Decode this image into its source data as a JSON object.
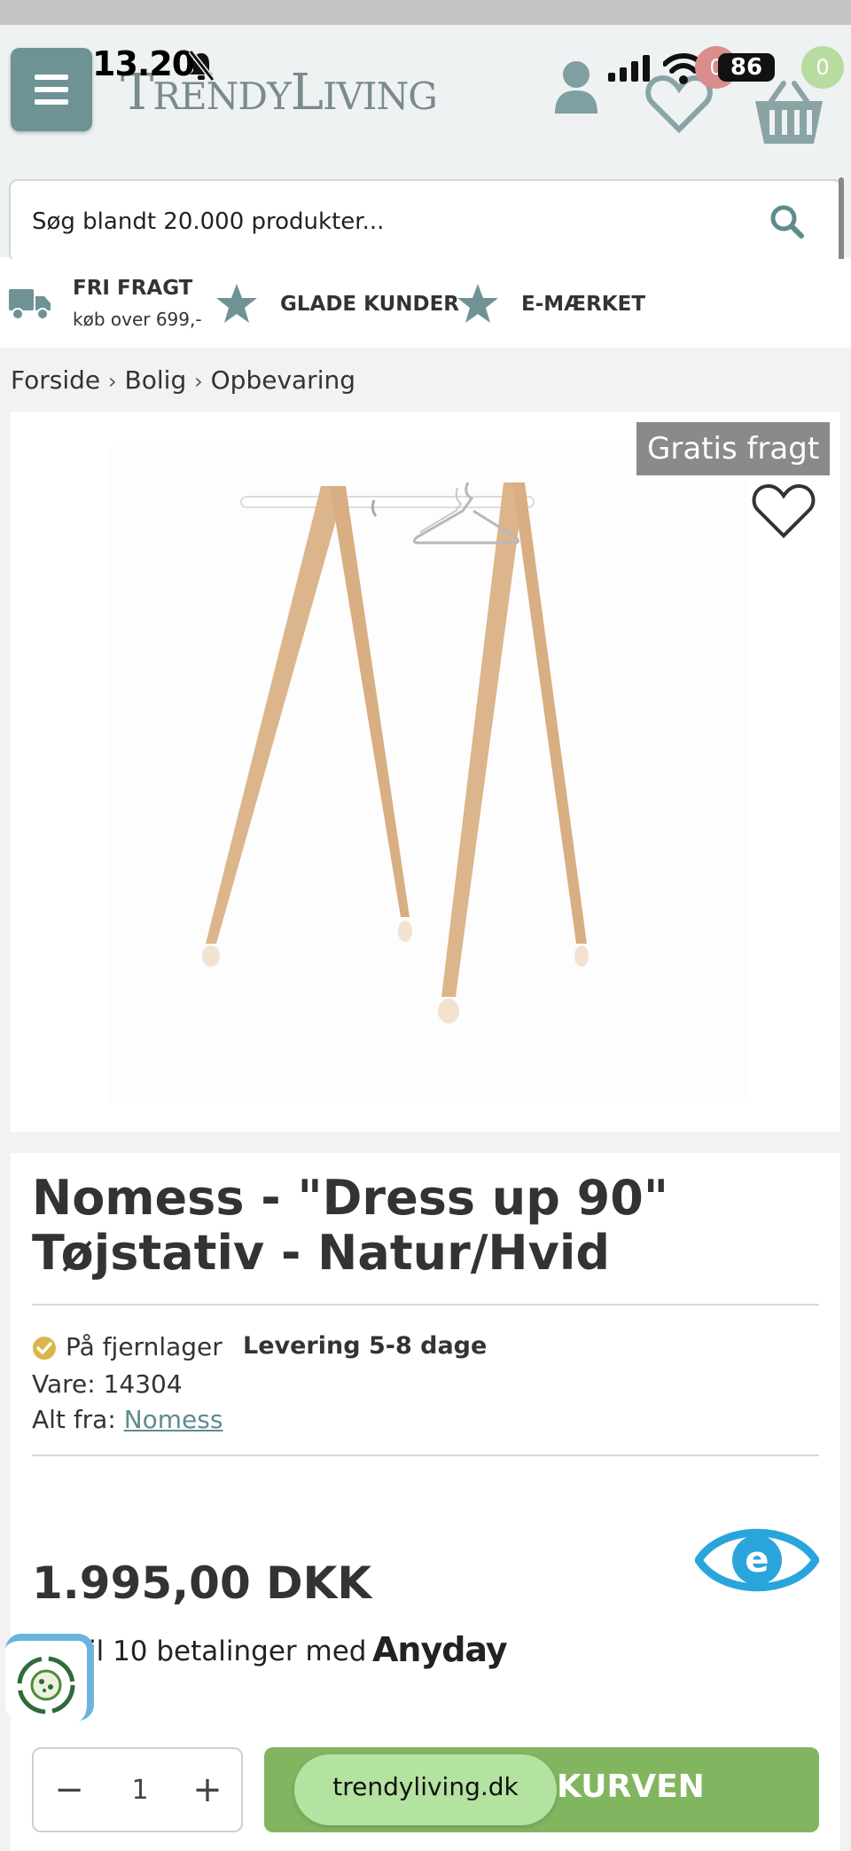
{
  "status": {
    "time": "13.20",
    "battery": "86"
  },
  "header": {
    "logo": {
      "first": "T",
      "rest1": "RENDY",
      "second": "L",
      "rest2": "IVING"
    },
    "wishlist_count": "0",
    "cart_count": "0"
  },
  "search": {
    "placeholder": "Søg blandt 20.000 produkter..."
  },
  "usp": {
    "free_shipping_title": "FRI FRAGT",
    "free_shipping_sub": "køb over 699,-",
    "happy_customers": "GLADE KUNDER",
    "emark": "E-MÆRKET"
  },
  "breadcrumb": {
    "items": [
      "Forside",
      "Bolig",
      "Opbevaring"
    ],
    "separator": "›"
  },
  "product": {
    "badge": "Gratis fragt",
    "title": "Nomess - \"Dress up 90\" Tøjstativ - Natur/Hvid",
    "stock": "På fjernlager",
    "delivery": "Levering 5-8 dage",
    "sku_label": "Vare:",
    "sku": "14304",
    "brand_label": "Alt fra:",
    "brand": "Nomess",
    "price": "1.995,00 DKK",
    "installment": "il 10 betalinger med",
    "installment_provider": "Anyday"
  },
  "purchase": {
    "minus": "−",
    "plus": "+",
    "quantity": "1",
    "cart_button": "KURVEN"
  },
  "browser": {
    "url": "trendyliving.dk"
  },
  "colors": {
    "accent_teal": "#6f9294",
    "cart_green": "#82b560",
    "badge_gray": "#8a8a8a",
    "emark_blue": "#2aa5dc"
  }
}
